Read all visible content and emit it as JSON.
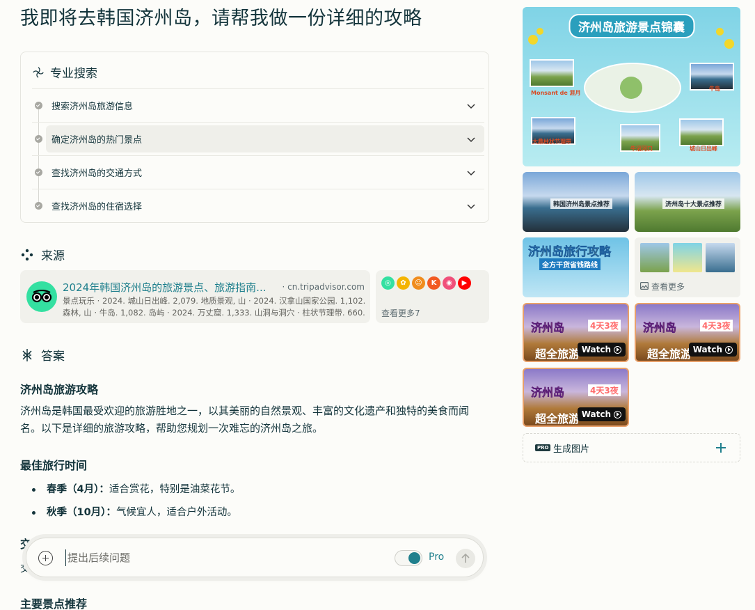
{
  "question": "我即将去韩国济州岛，请帮我做一份详细的攻略",
  "pro_search": {
    "title": "专业搜索",
    "steps": [
      {
        "label": "搜索济州岛旅游信息"
      },
      {
        "label": "确定济州岛的热门景点"
      },
      {
        "label": "查找济州岛的交通方式"
      },
      {
        "label": "查找济州岛的住宿选择"
      }
    ]
  },
  "sources": {
    "title": "来源",
    "first": {
      "title": "2024年韩国济州岛的旅游景点、旅游指南...",
      "domain": "· cn.tripadvisor.com",
      "snippet": "景点玩乐 · 2024. 城山日出峰. 2,079. 地质景观, 山 · 2024. 汉拿山国家公园. 1,102. 森林, 山 · 牛岛. 1,082. 岛屿 · 2024. 万丈窟. 1,333. 山洞与洞穴 · 柱状节理带. 660."
    },
    "more_label": "查看更多7",
    "favicons": [
      {
        "name": "tripadvisor-favicon-icon",
        "color": "#34e0a1",
        "glyph": "◎"
      },
      {
        "name": "pinwheel-favicon-icon",
        "color": "#f4b400",
        "glyph": "✿"
      },
      {
        "name": "mafengwo-favicon-icon",
        "color": "#f08c1d",
        "glyph": "☺"
      },
      {
        "name": "k-favicon-icon",
        "color": "#f25a22",
        "glyph": "K"
      },
      {
        "name": "qyer-favicon-icon",
        "color": "#f0507a",
        "glyph": "◉"
      },
      {
        "name": "youtube-favicon-icon",
        "color": "#ff0000",
        "glyph": "▶"
      }
    ]
  },
  "answer": {
    "title": "答案",
    "heading": "济州岛旅游攻略",
    "intro": "济州岛是韩国最受欢迎的旅游胜地之一，以其美丽的自然景观、丰富的文化遗产和独特的美食而闻名。以下是详细的旅游攻略，帮助您规划一次难忘的济州岛之旅。",
    "best_time_heading": "最佳旅行时间",
    "best_time": [
      {
        "season": "春季（4月）：",
        "desc": "适合赏花，特别是油菜花节。"
      },
      {
        "season": "秋季（10月）：",
        "desc": "气候宜人，适合户外活动。"
      }
    ],
    "partial_edge_1": "交",
    "partial_edge_2": "交",
    "attractions_heading": "主要景点推荐"
  },
  "followup": {
    "placeholder": "提出后续问题",
    "pro_label": "Pro",
    "pro_enabled": true
  },
  "media": {
    "big_title": "济州岛旅游景点锦囊",
    "big_captions": [
      "Monsant de 涯月",
      "牛岛",
      "大鼎柱状节理带",
      "牛沼河口",
      "城山日出峰"
    ],
    "tile2_caption": "韩国济州岛景点推荐",
    "tile3_caption": "济州岛十大景点推荐",
    "tile4_title": "济州岛旅行攻略",
    "tile4_sub": "全方干货省钱路线",
    "view_more": "查看更多",
    "video_title": "济州岛",
    "video_days": "4天3夜",
    "video_sub": "超全旅游",
    "watch_label": "Watch"
  },
  "generate_image": {
    "badge": "PRO",
    "label": "生成图片"
  }
}
